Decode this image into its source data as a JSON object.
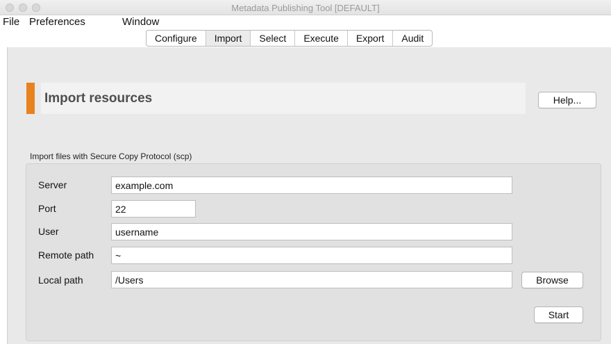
{
  "window": {
    "title": "Metadata Publishing Tool [DEFAULT]",
    "traffic_lights": [
      "close",
      "minimize",
      "zoom"
    ]
  },
  "menu": [
    "File",
    "Preferences",
    "Window"
  ],
  "tabs": [
    {
      "label": "Configure",
      "active": false
    },
    {
      "label": "Import",
      "active": true
    },
    {
      "label": "Select",
      "active": false
    },
    {
      "label": "Execute",
      "active": false
    },
    {
      "label": "Export",
      "active": false
    },
    {
      "label": "Audit",
      "active": false
    }
  ],
  "header": {
    "title": "Import resources",
    "help_label": "Help...",
    "accent_color": "#e8821e"
  },
  "scp": {
    "caption": "Import files with Secure Copy Protocol (scp)",
    "server": {
      "label": "Server",
      "value": "example.com"
    },
    "port": {
      "label": "Port",
      "value": "22"
    },
    "user": {
      "label": "User",
      "value": "username"
    },
    "remote_path": {
      "label": "Remote path",
      "value": "~"
    },
    "local_path": {
      "label": "Local path",
      "value": "/Users"
    },
    "browse_label": "Browse",
    "start_label": "Start"
  }
}
